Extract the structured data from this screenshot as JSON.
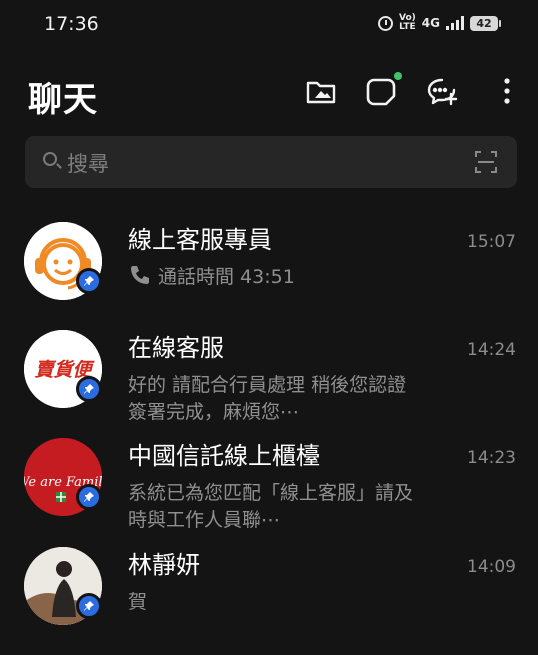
{
  "status_bar": {
    "time": "17:36",
    "volte": "Vo)\nLTE",
    "network": "4G",
    "battery": "42"
  },
  "header": {
    "title": "聊天"
  },
  "search": {
    "placeholder": "搜尋"
  },
  "colors": {
    "background": "#141414",
    "pin_badge": "#2b6de0",
    "notification_dot": "#3fc46a",
    "avatar_orange": "#f08a26",
    "avatar_red": "#c41c20"
  },
  "chats": [
    {
      "name": "線上客服專員",
      "time": "15:07",
      "preview": "通話時間 43:51",
      "preview_icon": "phone-icon",
      "pinned": true
    },
    {
      "name": "在線客服",
      "time": "14:24",
      "preview": "好的 請配合行員處理 稍後您認證簽署完成，麻煩您⋯",
      "avatar_text": "賣貨便",
      "pinned": true
    },
    {
      "name": "中國信託線上櫃檯",
      "time": "14:23",
      "preview": "系統已為您匹配「線上客服」請及時與工作人員聯⋯",
      "avatar_text": "We are Family",
      "pinned": true
    },
    {
      "name": "林靜妍",
      "time": "14:09",
      "preview": "賀",
      "pinned": true
    }
  ]
}
